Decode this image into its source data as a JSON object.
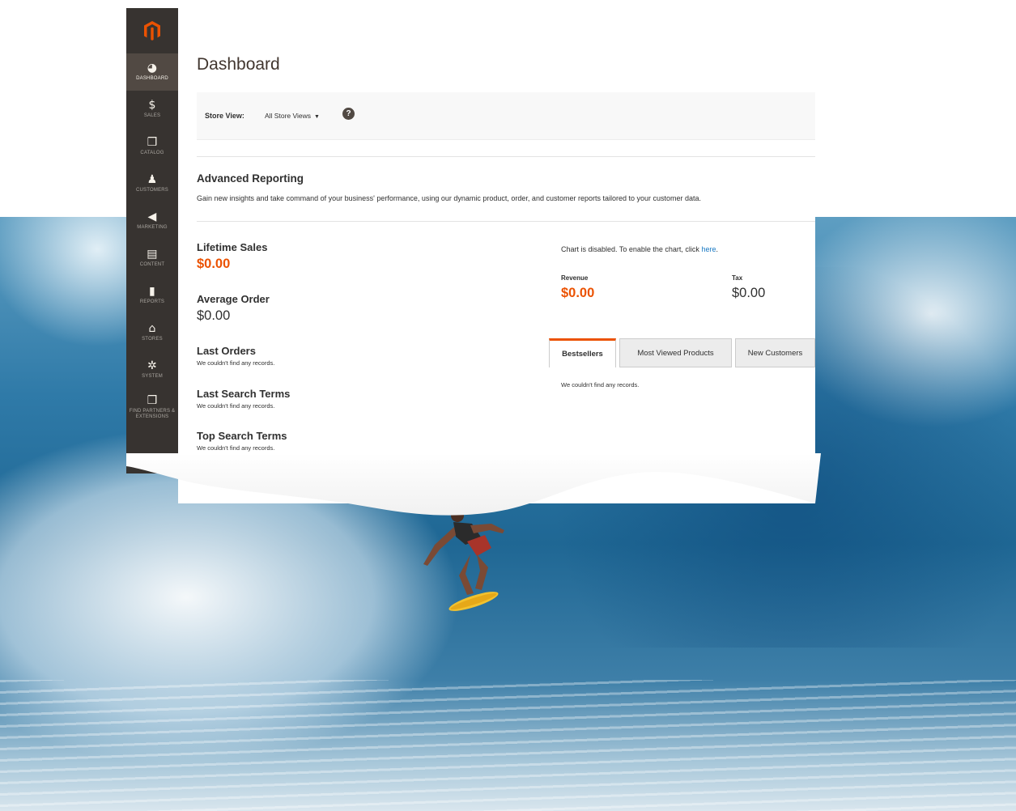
{
  "sidebar": {
    "logo_icon": "magento-logo-icon",
    "items": [
      {
        "label": "DASHBOARD",
        "icon": "speedometer-icon",
        "glyph": "◕",
        "active": true
      },
      {
        "label": "SALES",
        "icon": "dollar-icon",
        "glyph": "$",
        "active": false
      },
      {
        "label": "CATALOG",
        "icon": "cube-icon",
        "glyph": "❒",
        "active": false
      },
      {
        "label": "CUSTOMERS",
        "icon": "person-icon",
        "glyph": "♟",
        "active": false
      },
      {
        "label": "MARKETING",
        "icon": "megaphone-icon",
        "glyph": "◀",
        "active": false
      },
      {
        "label": "CONTENT",
        "icon": "layout-icon",
        "glyph": "▤",
        "active": false
      },
      {
        "label": "REPORTS",
        "icon": "bar-chart-icon",
        "glyph": "▮",
        "active": false
      },
      {
        "label": "STORES",
        "icon": "storefront-icon",
        "glyph": "⌂",
        "active": false
      },
      {
        "label": "SYSTEM",
        "icon": "gear-icon",
        "glyph": "✲",
        "active": false
      },
      {
        "label": "FIND PARTNERS & EXTENSIONS",
        "icon": "box-icon",
        "glyph": "❒",
        "active": false
      }
    ]
  },
  "page": {
    "title": "Dashboard"
  },
  "store_switcher": {
    "label": "Store View:",
    "value": "All Store Views",
    "caret": "▼",
    "help": "?"
  },
  "advanced_reporting": {
    "title": "Advanced Reporting",
    "text": "Gain new insights and take command of your business' performance, using our dynamic product, order, and customer reports tailored to your customer data."
  },
  "stats": {
    "lifetime_sales_label": "Lifetime Sales",
    "lifetime_sales_value": "$0.00",
    "average_order_label": "Average Order",
    "average_order_value": "$0.00",
    "last_orders_label": "Last Orders",
    "last_orders_note": "We couldn't find any records.",
    "last_search_label": "Last Search Terms",
    "last_search_note": "We couldn't find any records.",
    "top_search_label": "Top Search Terms",
    "top_search_note": "We couldn't find any records."
  },
  "chart": {
    "message": "Chart is disabled. To enable the chart, click ",
    "link": "here",
    "suffix": "."
  },
  "totals": {
    "revenue_label": "Revenue",
    "revenue_value": "$0.00",
    "tax_label": "Tax",
    "tax_value": "$0.00"
  },
  "tabs": {
    "items": [
      "Bestsellers",
      "Most Viewed Products",
      "New Customers"
    ],
    "note": "We couldn't find any records."
  },
  "colors": {
    "accent": "#eb5202",
    "sidebar": "#373330",
    "link": "#1979c3"
  }
}
